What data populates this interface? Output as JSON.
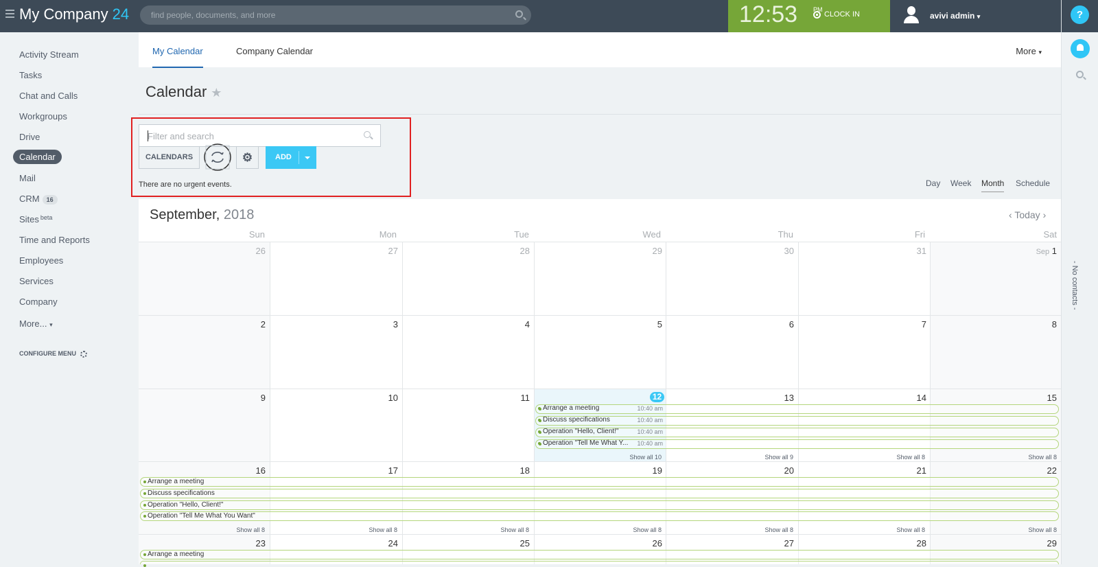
{
  "header": {
    "logo_text": "My Company",
    "logo_num": "24",
    "search_placeholder": "find people, documents, and more",
    "time": "12:53",
    "ampm": "PM",
    "clock_in": "CLOCK IN",
    "user": "avivi admin",
    "help": "?"
  },
  "sidebar": {
    "items": [
      {
        "label": "Activity Stream"
      },
      {
        "label": "Tasks"
      },
      {
        "label": "Chat and Calls"
      },
      {
        "label": "Workgroups"
      },
      {
        "label": "Drive"
      },
      {
        "label": "Calendar"
      },
      {
        "label": "Mail"
      },
      {
        "label": "CRM",
        "badge": "16"
      },
      {
        "label": "Sites",
        "sup": "beta"
      },
      {
        "label": "Time and Reports"
      },
      {
        "label": "Employees"
      },
      {
        "label": "Services"
      },
      {
        "label": "Company"
      },
      {
        "label": "More..."
      }
    ],
    "configure": "CONFIGURE MENU"
  },
  "tabs": {
    "my": "My Calendar",
    "company": "Company Calendar",
    "more": "More"
  },
  "page": {
    "title": "Calendar"
  },
  "toolbar": {
    "filter_placeholder": "Filter and search",
    "calendars": "CALENDARS",
    "add": "ADD",
    "urgent": "There are no urgent events."
  },
  "views": [
    "Day",
    "Week",
    "Month",
    "Schedule"
  ],
  "calendar": {
    "month": "September,",
    "year": "2018",
    "today": "Today",
    "days": [
      "Sun",
      "Mon",
      "Tue",
      "Wed",
      "Thu",
      "Fri",
      "Sat"
    ],
    "weeks": [
      [
        "26",
        "27",
        "28",
        "29",
        "30",
        "31",
        "1"
      ],
      [
        "2",
        "3",
        "4",
        "5",
        "6",
        "7",
        "8"
      ],
      [
        "9",
        "10",
        "11",
        "12",
        "13",
        "14",
        "15"
      ],
      [
        "16",
        "17",
        "18",
        "19",
        "20",
        "21",
        "22"
      ],
      [
        "23",
        "24",
        "25",
        "26",
        "27",
        "28",
        "29"
      ]
    ],
    "sep_prefix": "Sep",
    "events_wed": [
      {
        "title": "Arrange a meeting",
        "time": "10:40 am"
      },
      {
        "title": "Discuss specifications",
        "time": "10:40 am"
      },
      {
        "title": "Operation \"Hello, Client!\"",
        "time": "10:40 am"
      },
      {
        "title": "Operation \"Tell Me What Y...",
        "time": "10:40 am"
      }
    ],
    "events_week4": [
      "Arrange a meeting",
      "Discuss specifications",
      "Operation \"Hello, Client!\"",
      "Operation \"Tell Me What You Want\""
    ],
    "events_week5": [
      "Arrange a meeting"
    ],
    "showall_w3": [
      "Show all 10",
      "Show all 9",
      "Show all 8",
      "Show all 8"
    ],
    "showall_w4": [
      "Show all 8",
      "Show all 8",
      "Show all 8",
      "Show all 8",
      "Show all 8",
      "Show all 8",
      "Show all 8"
    ]
  },
  "right_panel": {
    "no_contacts": "- No contacts -"
  }
}
